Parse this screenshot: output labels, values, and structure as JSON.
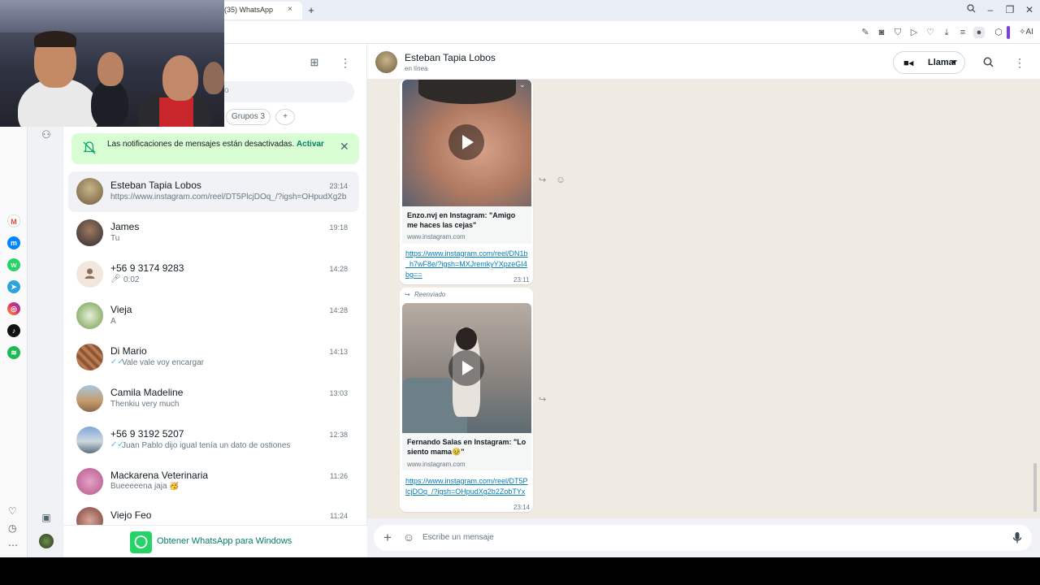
{
  "browser": {
    "tab_title": "(35) WhatsApp",
    "tab_close": "×",
    "new_tab": "+",
    "ai_label": "AI"
  },
  "sidebar_apps": [
    "M",
    "m",
    "w",
    "t",
    "ig",
    "tt",
    "sp"
  ],
  "chatlist": {
    "search_partial": "o",
    "filter_groups": "Grupos",
    "filter_groups_count": "3",
    "add_filter": "+",
    "notification": {
      "text": "Las notificaciones de mensajes están desactivadas.",
      "action": "Activar"
    },
    "chats": [
      {
        "name": "Esteban Tapia Lobos",
        "preview": "https://www.instagram.com/reel/DT5PlcjDOq_/?igsh=OHpudXg2b2...",
        "time": "23:14"
      },
      {
        "name": "James",
        "preview": "Tu",
        "time": "19:18"
      },
      {
        "name": "+56 9 3174 9283",
        "preview": "0:02",
        "time": "14:28"
      },
      {
        "name": "Vieja",
        "preview": "A",
        "time": "14:28"
      },
      {
        "name": "Di Mario",
        "preview": "Vale vale voy encargar",
        "time": "14:13"
      },
      {
        "name": "Camila Madeline",
        "preview": "Thenkiu very much",
        "time": "13:03"
      },
      {
        "name": "+56 9 3192 5207",
        "preview": "Juan Pablo dijo igual tenía un dato de ostiones",
        "time": "12:38"
      },
      {
        "name": "Mackarena Veterinaria",
        "preview": "Bueeeeena jaja 🥳",
        "time": "11:26"
      },
      {
        "name": "Viejo Feo",
        "preview": "",
        "time": "11:24"
      }
    ],
    "get_app": "Obtener WhatsApp para Windows"
  },
  "conversation": {
    "contact_name": "Esteban Tapia Lobos",
    "status": "en línea",
    "call_label": "Llamar",
    "messages": [
      {
        "preview_title": "Enzo.nvj en Instagram: \"Amigo me haces las cejas\"",
        "domain": "www.instagram.com",
        "link": "https://www.instagram.com/reel/DN1b_h7wF8e/?igsh=MXJremkyYXpzeGI4bg==",
        "time": "23:11"
      },
      {
        "forwarded_label": "Reenviado",
        "preview_title": "Fernando Salas en Instagram: \"Lo siento mama🥹\"",
        "domain": "www.instagram.com",
        "link": "https://www.instagram.com/reel/DT5PlcjDOq_/?igsh=OHpudXg2b2ZobTYx",
        "time": "23:14"
      }
    ],
    "composer_placeholder": "Escribe un mensaje"
  }
}
